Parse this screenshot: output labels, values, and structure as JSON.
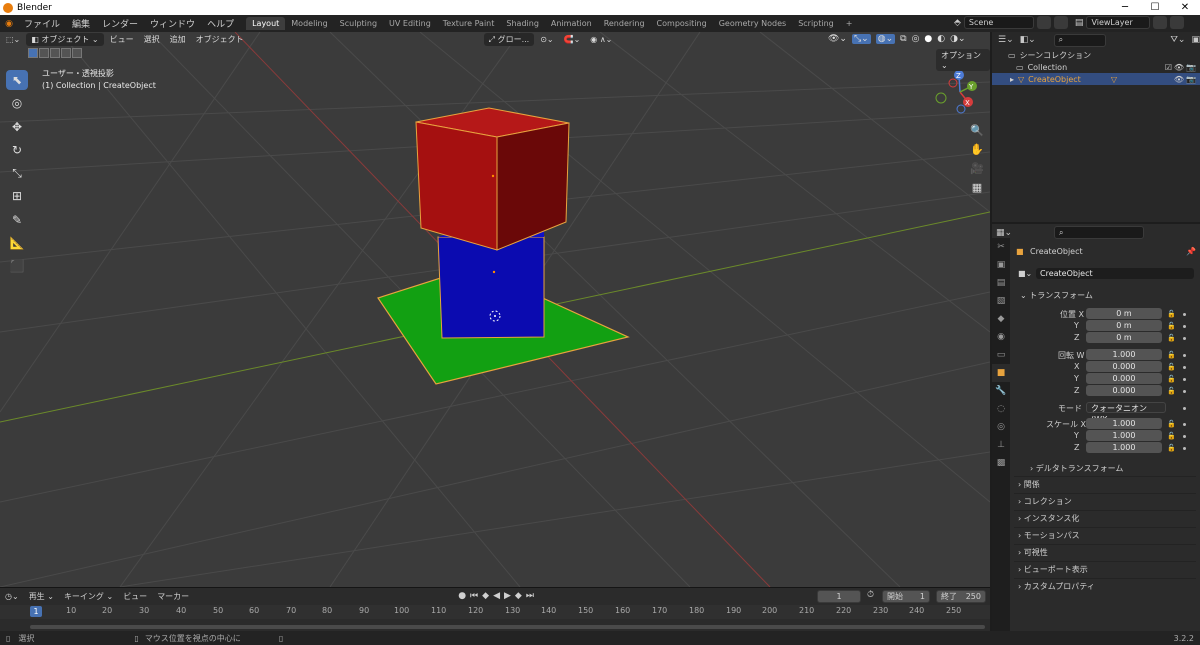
{
  "app": {
    "title": "Blender",
    "version": "3.2.2"
  },
  "window_buttons": [
    "─",
    "☐",
    "✕"
  ],
  "top_menu": [
    "ファイル",
    "編集",
    "レンダー",
    "ウィンドウ",
    "ヘルプ"
  ],
  "workspaces": [
    "Layout",
    "Modeling",
    "Sculpting",
    "UV Editing",
    "Texture Paint",
    "Shading",
    "Animation",
    "Rendering",
    "Compositing",
    "Geometry Nodes",
    "Scripting",
    "+"
  ],
  "active_workspace": "Layout",
  "scene": {
    "name": "Scene",
    "view_layer": "ViewLayer"
  },
  "viewport": {
    "mode": "オブジェクト",
    "menus": [
      "ビュー",
      "選択",
      "追加",
      "オブジェクト"
    ],
    "orientation": "グロー...",
    "view_name": "ユーザー・透視投影",
    "collection_info": "(1) Collection | CreateObject",
    "options_label": "オプション ⌄",
    "gizmo": {
      "x": "X",
      "y": "Y",
      "z": "Z"
    }
  },
  "timeline": {
    "menus": [
      "再生 ⌄",
      "キーイング ⌄",
      "ビュー",
      "マーカー"
    ],
    "current_frame": "1",
    "start_label": "開始",
    "start_value": "1",
    "end_label": "終了",
    "end_value": "250",
    "ruler": [
      "1",
      "10",
      "20",
      "30",
      "40",
      "50",
      "60",
      "70",
      "80",
      "90",
      "100",
      "110",
      "120",
      "130",
      "140",
      "150",
      "160",
      "170",
      "180",
      "190",
      "200",
      "210",
      "220",
      "230",
      "240",
      "250"
    ]
  },
  "statusbar": {
    "left": "選択",
    "middle": "マウス位置を視点の中心に"
  },
  "outliner": {
    "scene_collection": "シーンコレクション",
    "collection": "Collection",
    "object": "CreateObject"
  },
  "properties": {
    "object_name": "CreateObject",
    "object_field": "CreateObject",
    "transform_header": "トランスフォーム",
    "location": {
      "label_x": "位置 X",
      "label_y": "Y",
      "label_z": "Z",
      "x": "0 m",
      "y": "0 m",
      "z": "0 m"
    },
    "rotation": {
      "label_w": "回転 W",
      "label_x": "X",
      "label_y": "Y",
      "label_z": "Z",
      "w": "1.000",
      "x": "0.000",
      "y": "0.000",
      "z": "0.000"
    },
    "mode_label": "モード",
    "mode_value": "クォータニオン(WX...",
    "scale": {
      "label_x": "スケール X",
      "label_y": "Y",
      "label_z": "Z",
      "x": "1.000",
      "y": "1.000",
      "z": "1.000"
    },
    "delta_transform": "デルタトランスフォーム",
    "sections": [
      "関係",
      "コレクション",
      "インスタンス化",
      "モーションパス",
      "可視性",
      "ビューポート表示",
      "カスタムプロパティ"
    ]
  },
  "colors": {
    "accent": "#4772b3",
    "selected_outline": "#e8a33e",
    "cube_top": "#a81010",
    "cube_bottom": "#0a0aa8",
    "plane": "#10a010"
  }
}
